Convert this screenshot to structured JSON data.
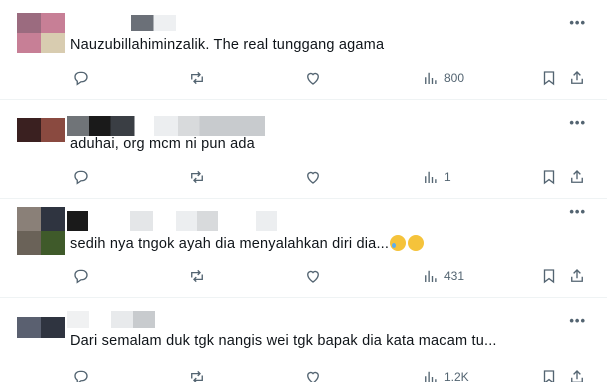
{
  "tweets": [
    {
      "text": "Nauzubillahiminzalik. The real tunggang agama",
      "views": "800",
      "avatar_colors": [
        "#9b6b7f",
        "#c77f96",
        "#d7a1b5",
        "#d8ccb0"
      ]
    },
    {
      "text": "aduhai, org mcm ni pun ada",
      "views": "1",
      "avatar_colors": [
        "#3a2020",
        "#8a4a40",
        "#3a2020",
        "#8a4a40"
      ]
    },
    {
      "text": "sedih nya tngok ayah dia menyalahkan diri dia...",
      "emojis": [
        "crying-face",
        "disappointed-face"
      ],
      "views": "431",
      "avatar_colors": [
        "#8a8078",
        "#2f3440",
        "#6a6258",
        "#3f5a2a"
      ]
    },
    {
      "text": "Dari semalam duk tgk nangis wei tgk bapak dia kata macam tu...",
      "views": "1.2K",
      "avatar_colors": [
        "#5a6070",
        "#2f3440",
        "#5a6070",
        "#2f3440"
      ]
    }
  ],
  "icons": {
    "more": "more-horizontal-icon",
    "reply": "reply-icon",
    "retweet": "retweet-icon",
    "like": "heart-icon",
    "views": "analytics-icon",
    "bookmark": "bookmark-icon",
    "share": "share-icon"
  },
  "more_glyph": "•••"
}
